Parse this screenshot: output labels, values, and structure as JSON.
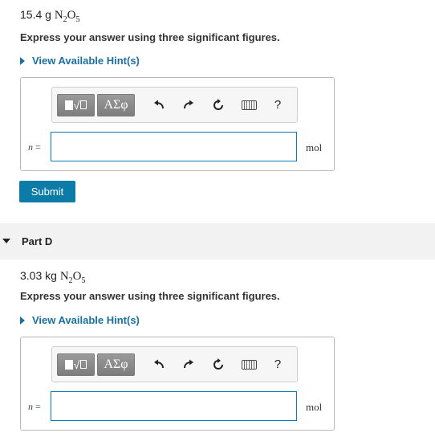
{
  "partC": {
    "question_prefix": "15.4 g",
    "formula_n": "N",
    "formula_sub1": "2",
    "formula_o": "O",
    "formula_sub2": "5",
    "instruction": "Express your answer using three significant figures.",
    "hint_label": "View Available Hint(s)",
    "var_label": "n",
    "eq": "=",
    "input_value": "",
    "unit": "mol",
    "submit_label": "Submit"
  },
  "partD": {
    "title": "Part D",
    "question_prefix": "3.03 kg",
    "formula_n": "N",
    "formula_sub1": "2",
    "formula_o": "O",
    "formula_sub2": "5",
    "instruction": "Express your answer using three significant figures.",
    "hint_label": "View Available Hint(s)",
    "var_label": "n",
    "eq": "=",
    "input_value": "",
    "unit": "mol"
  },
  "toolbar": {
    "greek_label": "ΑΣφ",
    "help_label": "?",
    "icons": [
      "templates-icon",
      "greek-symbols-icon",
      "undo-icon",
      "redo-icon",
      "reset-icon",
      "keyboard-icon",
      "help-icon"
    ]
  },
  "colors": {
    "accent": "#1a6fa3",
    "submit": "#0d7ba8",
    "input_border": "#0a7bbd"
  }
}
